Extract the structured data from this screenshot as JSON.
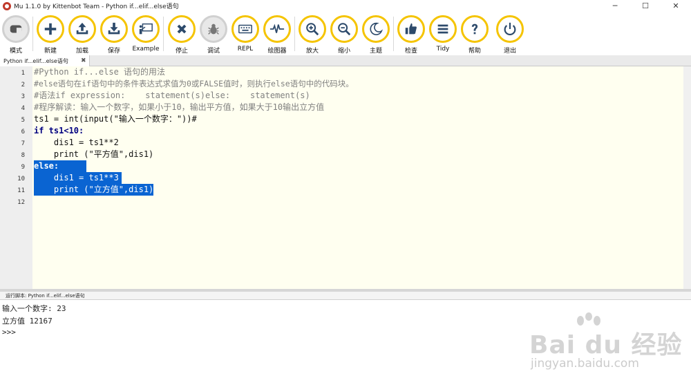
{
  "window": {
    "title": "Mu 1.1.0 by Kittenbot Team - Python if...elif...else语句",
    "minimize": "─",
    "maximize": "☐",
    "close": "✕"
  },
  "toolbar": {
    "buttons": [
      {
        "label": "模式",
        "icon": "mode-icon"
      },
      {
        "label": "新建",
        "icon": "plus-icon"
      },
      {
        "label": "加载",
        "icon": "upload-icon"
      },
      {
        "label": "保存",
        "icon": "download-icon"
      },
      {
        "label": "Example",
        "icon": "presentation-icon"
      },
      {
        "label": "停止",
        "icon": "x-icon"
      },
      {
        "label": "调试",
        "icon": "bug-icon"
      },
      {
        "label": "REPL",
        "icon": "keyboard-icon"
      },
      {
        "label": "绘图器",
        "icon": "pulse-icon"
      },
      {
        "label": "放大",
        "icon": "zoom-in-icon"
      },
      {
        "label": "缩小",
        "icon": "zoom-out-icon"
      },
      {
        "label": "主题",
        "icon": "moon-icon"
      },
      {
        "label": "检查",
        "icon": "thumbs-up-icon"
      },
      {
        "label": "Tidy",
        "icon": "lines-icon"
      },
      {
        "label": "帮助",
        "icon": "question-icon"
      },
      {
        "label": "退出",
        "icon": "power-icon"
      }
    ],
    "accent": "#f5c400"
  },
  "tab": {
    "label": "Python if...elif...else语句",
    "close": "✖"
  },
  "editor": {
    "line_numbers": [
      "1",
      "2",
      "3",
      "4",
      "5",
      "6",
      "7",
      "8",
      "9",
      "10",
      "11",
      "12"
    ],
    "lines": [
      "#Python if...else 语句的用法",
      "#else语句在if语句中的条件表达式求值为0或FALSE值时，则执行else语句中的代码块。",
      "#语法if expression:    statement(s)else:    statement(s)",
      "#程序解读：输入一个数字，如果小于10，输出平方值，如果大于10输出立方值",
      "ts1 = int(input(\"输入一个数字：\"))#",
      "if ts1<10:",
      "    dis1 = ts1**2",
      "    print (\"平方值\",dis1)",
      "else:",
      "    dis1 = ts1**3",
      "    print (\"立方值\",dis1)",
      ""
    ],
    "selection_color": "#0a64d2"
  },
  "run_panel": {
    "header": "运行脚本: Python if...elif...else语句",
    "output": [
      "输入一个数字: 23",
      "立方值 12167",
      ">>> "
    ]
  },
  "watermark": {
    "logo": "Bai du 经验",
    "url": "jingyan.baidu.com"
  }
}
